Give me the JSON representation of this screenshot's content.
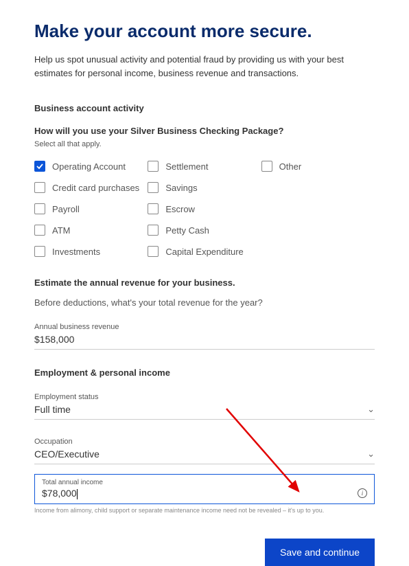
{
  "page_title": "Make your account more secure.",
  "intro": "Help us spot unusual activity and potential fraud by providing us with your best estimates for personal income, business revenue and transactions.",
  "business_activity_title": "Business account activity",
  "usage_question": "How will you use your Silver Business Checking Package?",
  "usage_hint": "Select all that apply.",
  "checkboxes": [
    {
      "label": "Operating Account",
      "checked": true
    },
    {
      "label": "Credit card purchases",
      "checked": false
    },
    {
      "label": "Payroll",
      "checked": false
    },
    {
      "label": "ATM",
      "checked": false
    },
    {
      "label": "Investments",
      "checked": false
    },
    {
      "label": "Settlement",
      "checked": false
    },
    {
      "label": "Savings",
      "checked": false
    },
    {
      "label": "Escrow",
      "checked": false
    },
    {
      "label": "Petty Cash",
      "checked": false
    },
    {
      "label": "Capital Expenditure",
      "checked": false
    },
    {
      "label": "Other",
      "checked": false
    }
  ],
  "revenue_title": "Estimate the annual revenue for your business.",
  "revenue_sub": "Before deductions, what's your total revenue for the year?",
  "annual_revenue_label": "Annual business revenue",
  "annual_revenue_value": "$158,000",
  "employment_title": "Employment & personal income",
  "employment_status_label": "Employment status",
  "employment_status_value": "Full time",
  "occupation_label": "Occupation",
  "occupation_value": "CEO/Executive",
  "total_income_label": "Total annual income",
  "total_income_value": "$78,000",
  "income_disclaimer": "Income from alimony, child support or separate maintenance income need not be revealed – it's up to you.",
  "save_button": "Save and continue"
}
